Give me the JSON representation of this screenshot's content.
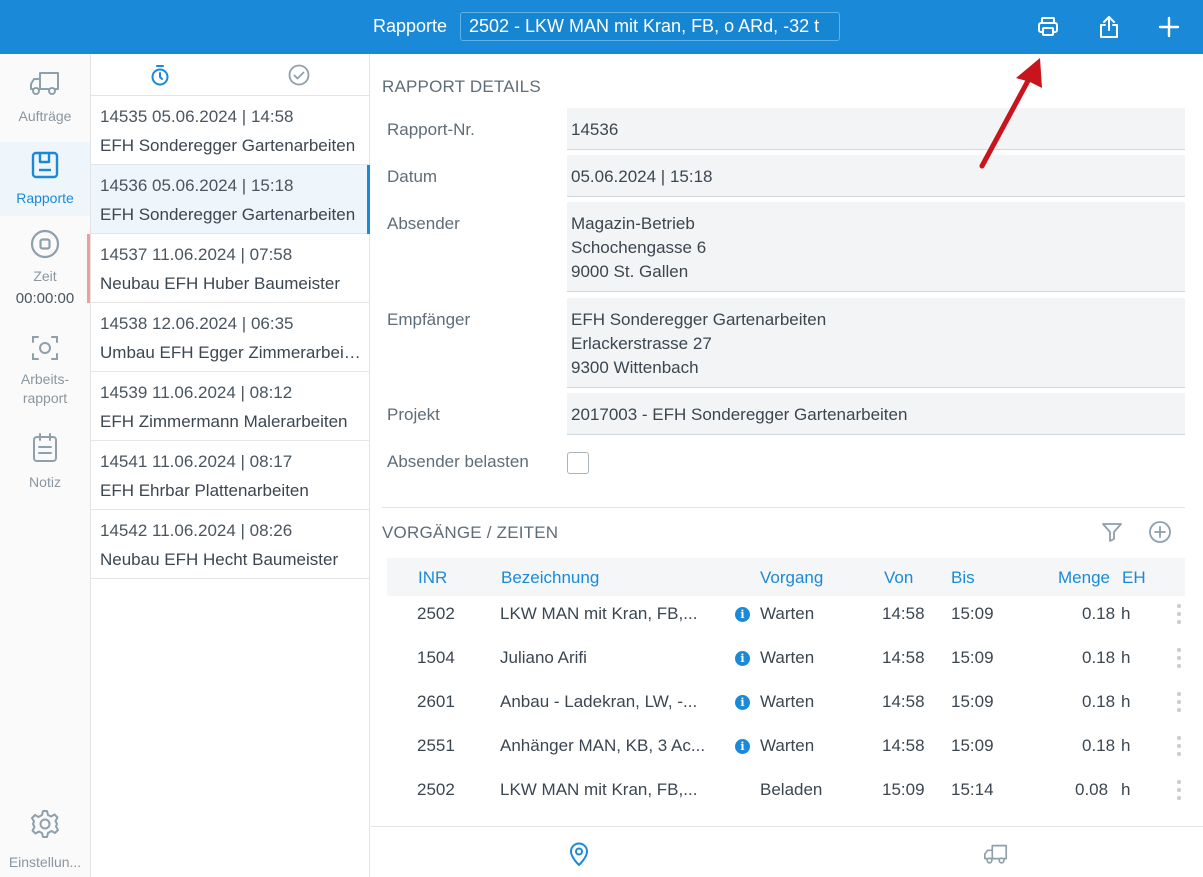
{
  "topbar": {
    "title": "Rapporte",
    "selected": "2502 - LKW MAN mit Kran, FB, o ARd, -32 t",
    "print_icon": "printer-icon",
    "share_icon": "share-icon",
    "add_icon": "plus-icon"
  },
  "nav": {
    "items": [
      {
        "label": "Aufträge",
        "icon": "truck-icon"
      },
      {
        "label": "Rapporte",
        "icon": "report-icon"
      },
      {
        "label": "Zeit",
        "icon": "stop-icon",
        "time": "00:00:00"
      },
      {
        "label": "Arbeits-\nrapport",
        "label1": "Arbeits-",
        "label2": "rapport",
        "icon": "scan-icon"
      },
      {
        "label": "Notiz",
        "icon": "notepad-icon"
      }
    ],
    "settings_label": "Einstellun..."
  },
  "list": {
    "tabs": [
      "timer-icon",
      "check-circle-icon"
    ],
    "items": [
      {
        "line1": "14535  05.06.2024 | 14:58",
        "line2": "EFH Sonderegger Gartenarbeiten"
      },
      {
        "line1": "14536  05.06.2024 | 15:18",
        "line2": "EFH Sonderegger Gartenarbeiten"
      },
      {
        "line1": "14537  11.06.2024 | 07:58",
        "line2": "Neubau EFH Huber Baumeister"
      },
      {
        "line1": "14538  12.06.2024 | 06:35",
        "line2": "Umbau EFH Egger Zimmerarbeiten"
      },
      {
        "line1": "14539  11.06.2024 | 08:12",
        "line2": "EFH Zimmermann Malerarbeiten"
      },
      {
        "line1": "14541  11.06.2024 | 08:17",
        "line2": "EFH Ehrbar Plattenarbeiten"
      },
      {
        "line1": "14542  11.06.2024 | 08:26",
        "line2": "Neubau EFH Hecht Baumeister"
      }
    ]
  },
  "detail": {
    "section_title": "RAPPORT DETAILS",
    "fields": {
      "nr_label": "Rapport-Nr.",
      "nr_value": "14536",
      "datum_label": "Datum",
      "datum_value": "05.06.2024 | 15:18",
      "absender_label": "Absender",
      "absender_l1": "Magazin-Betrieb",
      "absender_l2": "Schochengasse 6",
      "absender_l3": "9000 St. Gallen",
      "empf_label": "Empfänger",
      "empf_l1": "EFH Sonderegger Gartenarbeiten",
      "empf_l2": "Erlackerstrasse 27",
      "empf_l3": "9300 Wittenbach",
      "projekt_label": "Projekt",
      "projekt_value": "2017003 - EFH Sonderegger Gartenarbeiten",
      "belasten_label": "Absender belasten",
      "belasten_checked": false
    },
    "vorgaenge_title": "VORGÄNGE / ZEITEN",
    "table": {
      "headers": [
        "INR",
        "Bezeichnung",
        "Vorgang",
        "Von",
        "Bis",
        "Menge",
        "EH"
      ],
      "rows": [
        {
          "inr": "2502",
          "bez": "LKW MAN mit Kran, FB,...",
          "info": true,
          "vorgang": "Warten",
          "von": "14:58",
          "bis": "15:09",
          "menge": "0.18",
          "eh": "h"
        },
        {
          "inr": "1504",
          "bez": "Juliano Arifi",
          "info": true,
          "vorgang": "Warten",
          "von": "14:58",
          "bis": "15:09",
          "menge": "0.18",
          "eh": "h"
        },
        {
          "inr": "2601",
          "bez": "Anbau - Ladekran, LW, -...",
          "info": true,
          "vorgang": "Warten",
          "von": "14:58",
          "bis": "15:09",
          "menge": "0.18",
          "eh": "h"
        },
        {
          "inr": "2551",
          "bez": "Anhänger MAN, KB, 3 Ac...",
          "info": true,
          "vorgang": "Warten",
          "von": "14:58",
          "bis": "15:09",
          "menge": "0.18",
          "eh": "h"
        },
        {
          "inr": "2502",
          "bez": "LKW MAN mit Kran, FB,...",
          "info": false,
          "vorgang": "Beladen",
          "von": "15:09",
          "bis": "15:14",
          "menge": "0.08",
          "eh": "h"
        }
      ]
    }
  },
  "bottom": {
    "icons": [
      "location-pin-icon",
      "truck-icon"
    ]
  },
  "colors": {
    "accent": "#1a8ad8",
    "flag": "#f19ca0",
    "arrow": "#c8141c"
  }
}
